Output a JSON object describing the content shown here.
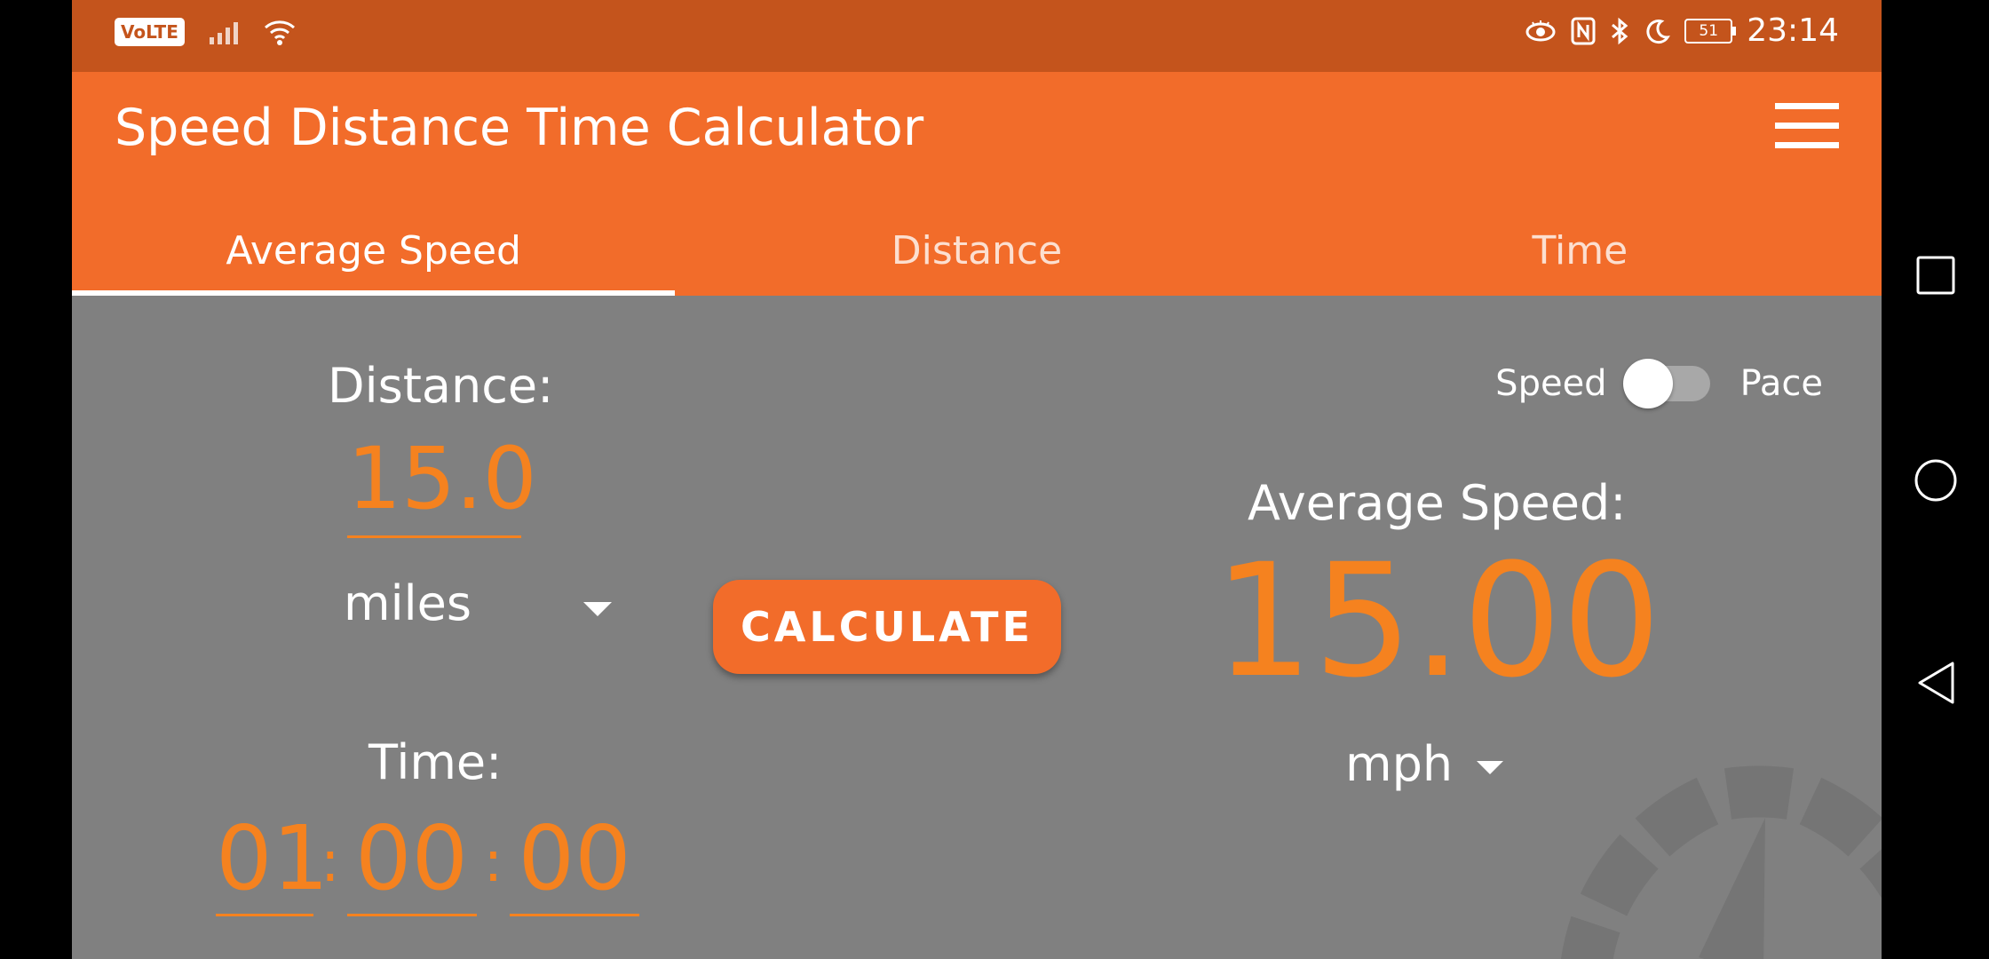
{
  "status_bar": {
    "network_badge": "VoLTE",
    "battery_level": "51",
    "time": "23:14"
  },
  "app_title": "Speed Distance Time Calculator",
  "tabs": [
    {
      "label": "Average Speed",
      "active": true
    },
    {
      "label": "Distance",
      "active": false
    },
    {
      "label": "Time",
      "active": false
    }
  ],
  "form": {
    "distance_label": "Distance:",
    "distance_value": "15.0",
    "distance_unit": "miles",
    "time_label": "Time:",
    "time_hours": "01",
    "time_minutes": "00",
    "time_seconds": "00",
    "colon": ":"
  },
  "calculate_label": "CALCULATE",
  "toggle": {
    "left_label": "Speed",
    "right_label": "Pace",
    "state": "Speed"
  },
  "result": {
    "label": "Average Speed:",
    "value": "15.00",
    "unit": "mph"
  },
  "colors": {
    "accent": "#f26c2a",
    "status_bar": "#c4541c",
    "value_text": "#f5821f",
    "background": "#808080"
  },
  "icons": [
    "menu-icon",
    "eye-icon",
    "nfc-icon",
    "bluetooth-icon",
    "moon-icon",
    "wifi-icon",
    "speedometer-icon"
  ]
}
